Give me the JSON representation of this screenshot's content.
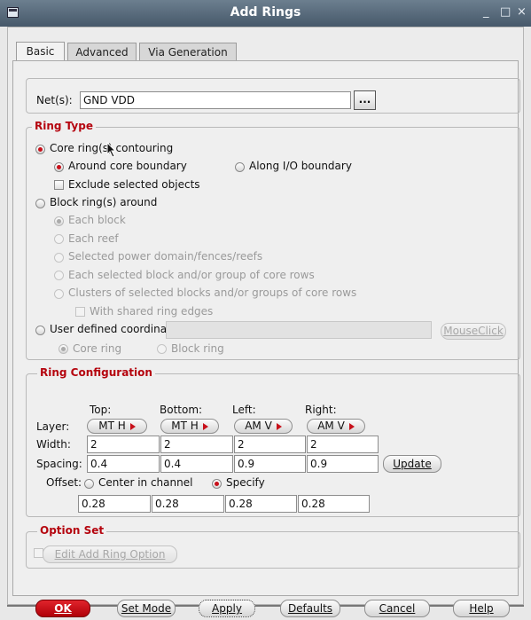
{
  "window": {
    "title": "Add Rings",
    "minimize": "_",
    "maximize": "□",
    "close": "×"
  },
  "tabs": [
    {
      "label": "Basic"
    },
    {
      "label": "Advanced"
    },
    {
      "label": "Via Generation"
    }
  ],
  "nets": {
    "label": "Net(s):",
    "value": "GND VDD",
    "browse": "..."
  },
  "ring_type": {
    "title": "Ring Type",
    "core_ring": "Core ring(s) contouring",
    "around_core": "Around core boundary",
    "along_io": "Along I/O boundary",
    "exclude_selected": "Exclude selected objects",
    "block_rings": "Block ring(s) around",
    "each_block": "Each block",
    "each_reef": "Each reef",
    "selected_power_domain": "Selected power domain/fences/reefs",
    "each_selected_block": "Each selected block and/or group of core rows",
    "clusters": "Clusters of selected blocks and/or groups of core rows",
    "shared_edges": "With shared ring edges",
    "user_defined": "User defined coordinates:",
    "mouse_click": "MouseClick",
    "core_ring_opt": "Core ring",
    "block_ring_opt": "Block ring"
  },
  "ring_config": {
    "title": "Ring Configuration",
    "columns": [
      "Top:",
      "Bottom:",
      "Left:",
      "Right:"
    ],
    "layer_label": "Layer:",
    "layers": [
      "MT H",
      "MT H",
      "AM V",
      "AM V"
    ],
    "width_label": "Width:",
    "widths": [
      "2",
      "2",
      "2",
      "2"
    ],
    "spacing_label": "Spacing:",
    "spacings": [
      "0.4",
      "0.4",
      "0.9",
      "0.9"
    ],
    "update": "Update",
    "offset_label": "Offset:",
    "center_in_channel": "Center in channel",
    "specify": "Specify",
    "offsets": [
      "0.28",
      "0.28",
      "0.28",
      "0.28"
    ]
  },
  "option_set": {
    "title": "Option Set",
    "edit_button": "Edit Add Ring Option"
  },
  "buttons": {
    "ok": "OK",
    "set_mode": "Set Mode",
    "apply": "Apply",
    "defaults": "Defaults",
    "cancel": "Cancel",
    "help": "Help"
  },
  "colors": {
    "accent_red": "#c8101a",
    "titlebar": "#46586a"
  }
}
